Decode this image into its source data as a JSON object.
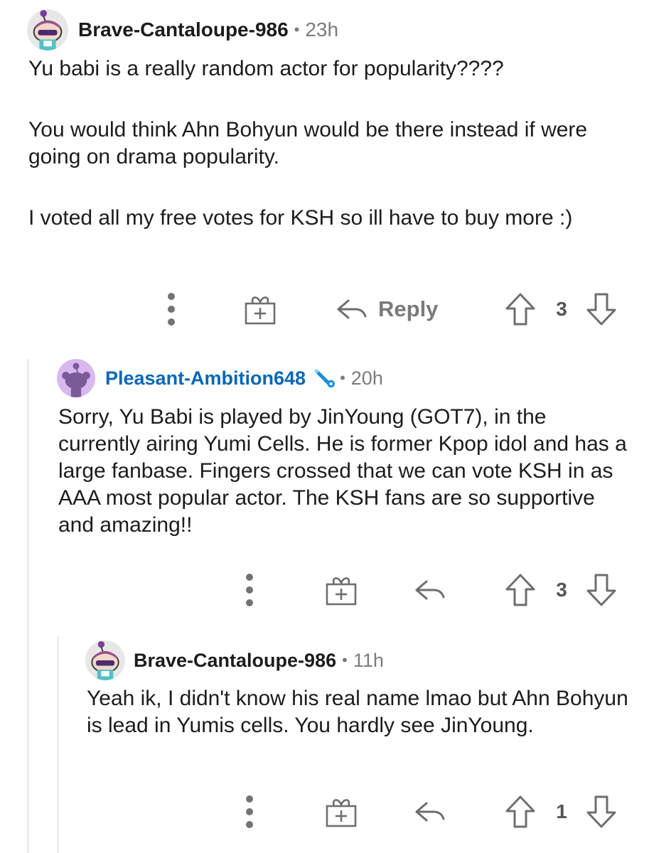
{
  "comments": [
    {
      "username": "Brave-Cantaloupe-986",
      "age": "23h",
      "paragraphs": [
        "Yu babi is a really random actor for popularity????",
        "You would think Ahn Bohyun would be there instead if were going on drama popularity.",
        "I voted all my free votes for KSH so ill have to buy more :)"
      ],
      "reply_label": "Reply",
      "votes": "3"
    },
    {
      "username": "Pleasant-Ambition648",
      "age": "20h",
      "paragraphs": [
        "Sorry, Yu Babi is played by JinYoung (GOT7), in the currently airing Yumi Cells. He is former Kpop idol and has a large fanbase. Fingers crossed that we can vote KSH in as AAA most popular actor.  The KSH fans are so supportive and amazing!!"
      ],
      "votes": "3"
    },
    {
      "username": "Brave-Cantaloupe-986",
      "age": "11h",
      "paragraphs": [
        "Yeah ik, I didn't know his real name lmao but Ahn Bohyun is lead in Yumis cells. You hardly see JinYoung."
      ],
      "votes": "1"
    }
  ],
  "separator": "•",
  "icons": {
    "more": "more-vertical-icon",
    "gift": "gift-award-icon",
    "reply": "reply-arrow-icon",
    "upvote": "upvote-arrow-icon",
    "downvote": "downvote-arrow-icon",
    "moderator": "wrench-flair-icon"
  },
  "colors": {
    "username_blue": "#0a67b6",
    "muted_text": "#7c7c7c",
    "thread_line": "#ededed",
    "avatar_purple": "#d9b8f0"
  }
}
